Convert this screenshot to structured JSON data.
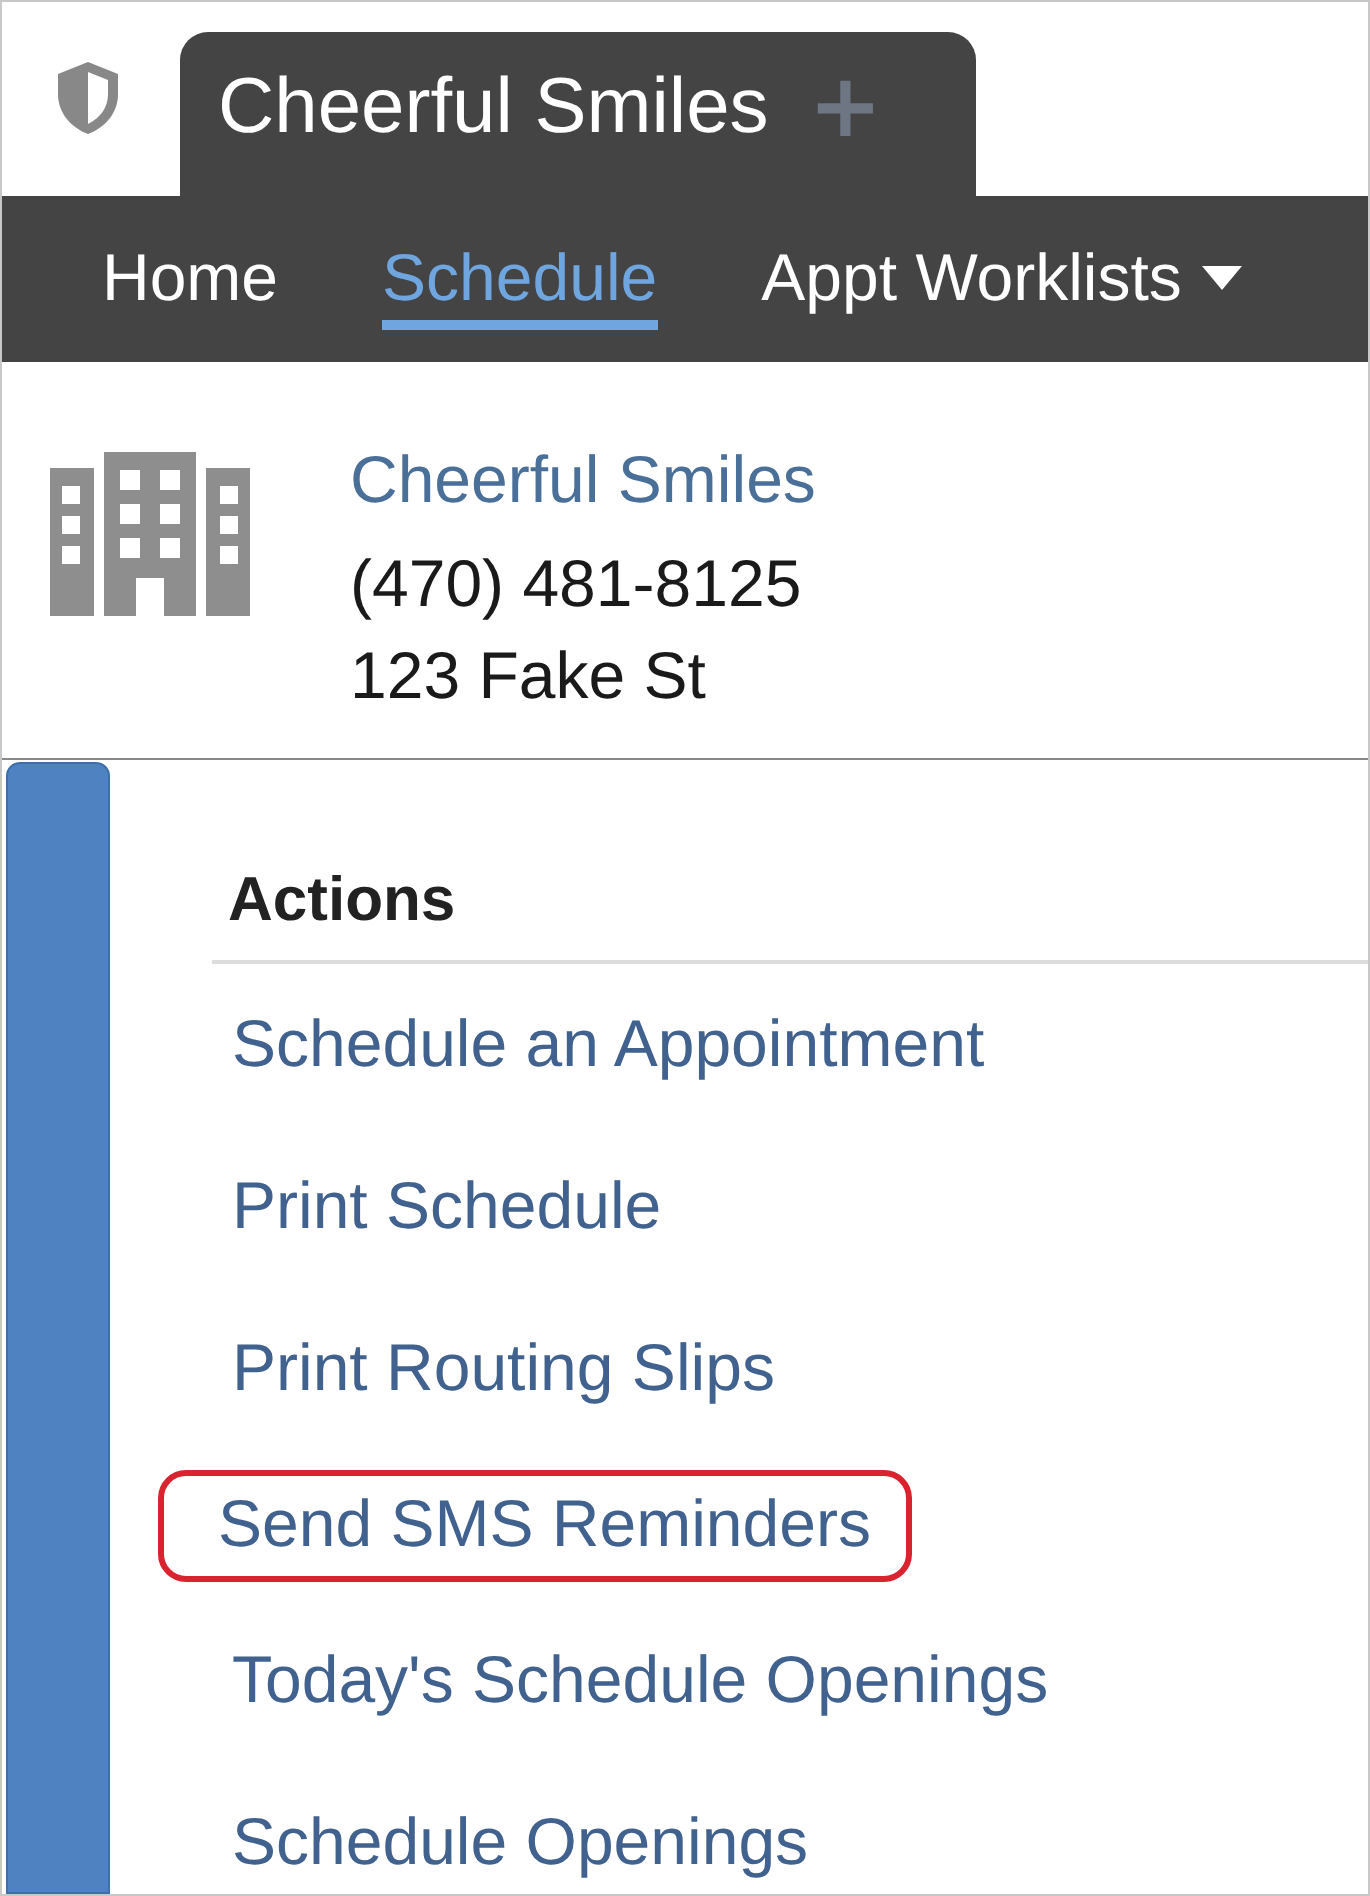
{
  "app_tab": {
    "title": "Cheerful Smiles",
    "add": "+"
  },
  "nav": [
    {
      "label": "Home",
      "selected": false,
      "dropdown": false
    },
    {
      "label": "Schedule",
      "selected": true,
      "dropdown": false
    },
    {
      "label": "Appt Worklists",
      "selected": false,
      "dropdown": true
    }
  ],
  "practice": {
    "name": "Cheerful Smiles",
    "phone": "(470) 481-8125",
    "address": "123 Fake St"
  },
  "actions": {
    "heading": "Actions",
    "items": [
      {
        "label": "Schedule an Appointment",
        "highlighted": false
      },
      {
        "label": "Print Schedule",
        "highlighted": false
      },
      {
        "label": "Print Routing Slips",
        "highlighted": false
      },
      {
        "label": "Send SMS Reminders",
        "highlighted": true
      },
      {
        "label": "Today's Schedule Openings",
        "highlighted": false
      },
      {
        "label": "Schedule Openings",
        "highlighted": false
      }
    ]
  }
}
